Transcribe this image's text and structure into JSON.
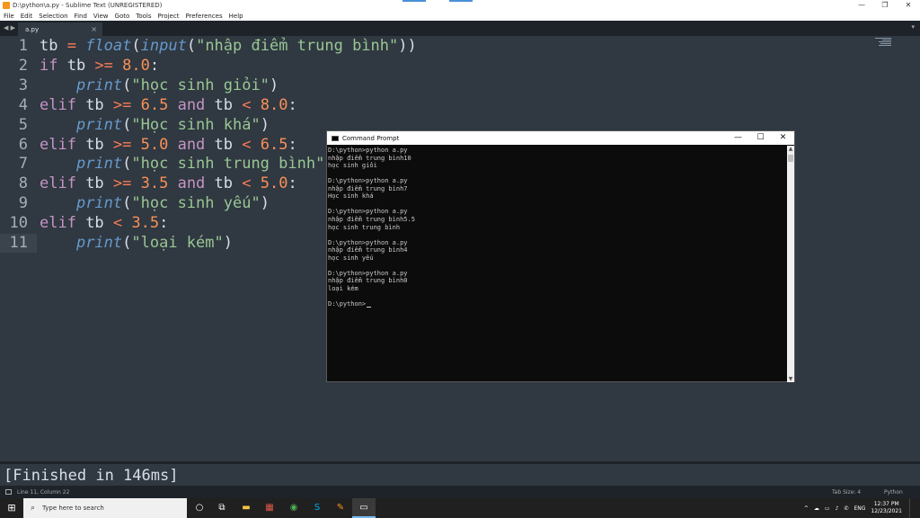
{
  "window": {
    "title": "D:\\python\\a.py - Sublime Text (UNREGISTERED)",
    "minimize": "—",
    "maximize": "❐",
    "close": "✕"
  },
  "menu": [
    "File",
    "Edit",
    "Selection",
    "Find",
    "View",
    "Goto",
    "Tools",
    "Project",
    "Preferences",
    "Help"
  ],
  "tabs": {
    "nav": "◀ ▶",
    "active": {
      "label": "a.py",
      "close": "×"
    },
    "overflow": "▾"
  },
  "editor": {
    "line_numbers": [
      "1",
      "2",
      "3",
      "4",
      "5",
      "6",
      "7",
      "8",
      "9",
      "10",
      "11"
    ],
    "current_line": 11,
    "lines": [
      [
        [
          "v",
          "tb "
        ],
        [
          "op",
          "= "
        ],
        [
          "fn",
          "float"
        ],
        [
          "v",
          "("
        ],
        [
          "fn",
          "input"
        ],
        [
          "v",
          "("
        ],
        [
          "str",
          "\"nhập điểm trung bình\""
        ],
        [
          "v",
          "))"
        ]
      ],
      [
        [
          "kw",
          "if "
        ],
        [
          "v",
          "tb "
        ],
        [
          "op",
          ">= "
        ],
        [
          "num",
          "8.0"
        ],
        [
          "v",
          ":"
        ]
      ],
      [
        [
          "v",
          "    "
        ],
        [
          "fn",
          "print"
        ],
        [
          "v",
          "("
        ],
        [
          "str",
          "\"học sinh giỏi\""
        ],
        [
          "v",
          ")"
        ]
      ],
      [
        [
          "kw",
          "elif "
        ],
        [
          "v",
          "tb "
        ],
        [
          "op",
          ">= "
        ],
        [
          "num",
          "6.5 "
        ],
        [
          "kw",
          "and "
        ],
        [
          "v",
          "tb "
        ],
        [
          "op",
          "< "
        ],
        [
          "num",
          "8.0"
        ],
        [
          "v",
          ":"
        ]
      ],
      [
        [
          "v",
          "    "
        ],
        [
          "fn",
          "print"
        ],
        [
          "v",
          "("
        ],
        [
          "str",
          "\"Học sinh khá\""
        ],
        [
          "v",
          ")"
        ]
      ],
      [
        [
          "kw",
          "elif "
        ],
        [
          "v",
          "tb "
        ],
        [
          "op",
          ">= "
        ],
        [
          "num",
          "5.0 "
        ],
        [
          "kw",
          "and "
        ],
        [
          "v",
          "tb "
        ],
        [
          "op",
          "< "
        ],
        [
          "num",
          "6.5"
        ],
        [
          "v",
          ":"
        ]
      ],
      [
        [
          "v",
          "    "
        ],
        [
          "fn",
          "print"
        ],
        [
          "v",
          "("
        ],
        [
          "str",
          "\"học sinh trung bình\""
        ]
      ],
      [
        [
          "kw",
          "elif "
        ],
        [
          "v",
          "tb "
        ],
        [
          "op",
          ">= "
        ],
        [
          "num",
          "3.5 "
        ],
        [
          "kw",
          "and "
        ],
        [
          "v",
          "tb "
        ],
        [
          "op",
          "< "
        ],
        [
          "num",
          "5.0"
        ],
        [
          "v",
          ":"
        ]
      ],
      [
        [
          "v",
          "    "
        ],
        [
          "fn",
          "print"
        ],
        [
          "v",
          "("
        ],
        [
          "str",
          "\"học sinh yếu\""
        ],
        [
          "v",
          ")"
        ]
      ],
      [
        [
          "kw",
          "elif "
        ],
        [
          "v",
          "tb "
        ],
        [
          "op",
          "< "
        ],
        [
          "num",
          "3.5"
        ],
        [
          "v",
          ":"
        ]
      ],
      [
        [
          "v",
          "    "
        ],
        [
          "fn",
          "print"
        ],
        [
          "v",
          "("
        ],
        [
          "str",
          "\"loại kém\""
        ],
        [
          "v",
          ")"
        ]
      ]
    ]
  },
  "cmd": {
    "title": "Command Prompt",
    "minimize": "—",
    "maximize": "☐",
    "close": "✕",
    "lines": [
      "D:\\python>python a.py",
      "nhập điểm trung bình10",
      "học sinh giỏi",
      "",
      "D:\\python>python a.py",
      "nhập điểm trung bình7",
      "Học sinh khá",
      "",
      "D:\\python>python a.py",
      "nhập điểm trung bình5.5",
      "học sinh trung bình",
      "",
      "D:\\python>python a.py",
      "nhập điểm trung bình4",
      "học sinh yếu",
      "",
      "D:\\python>python a.py",
      "nhập điểm trung bình0",
      "loại kém",
      "",
      "D:\\python>"
    ],
    "scroll_up": "▲",
    "scroll_down": "▼"
  },
  "output": {
    "text": "[Finished in 146ms]"
  },
  "status": {
    "position": "Line 11, Column 22",
    "tab_size": "Tab Size: 4",
    "syntax": "Python"
  },
  "taskbar": {
    "start": "⊞",
    "search_placeholder": "Type here to search",
    "search_icon": "⌕",
    "icons": [
      "○",
      "⧉",
      "▬",
      "▦",
      "◉",
      "S",
      "✎",
      "▭"
    ],
    "tray": [
      "^",
      "☁",
      "▭",
      "♪",
      "✆"
    ],
    "lang": "ENG",
    "time": "12:37 PM",
    "date": "12/23/2021"
  },
  "colors": {
    "editor_bg": "#303841",
    "keyword": "#c594c5",
    "function": "#6699cc",
    "string": "#99c794",
    "number": "#f99157",
    "operator": "#f97b58"
  }
}
